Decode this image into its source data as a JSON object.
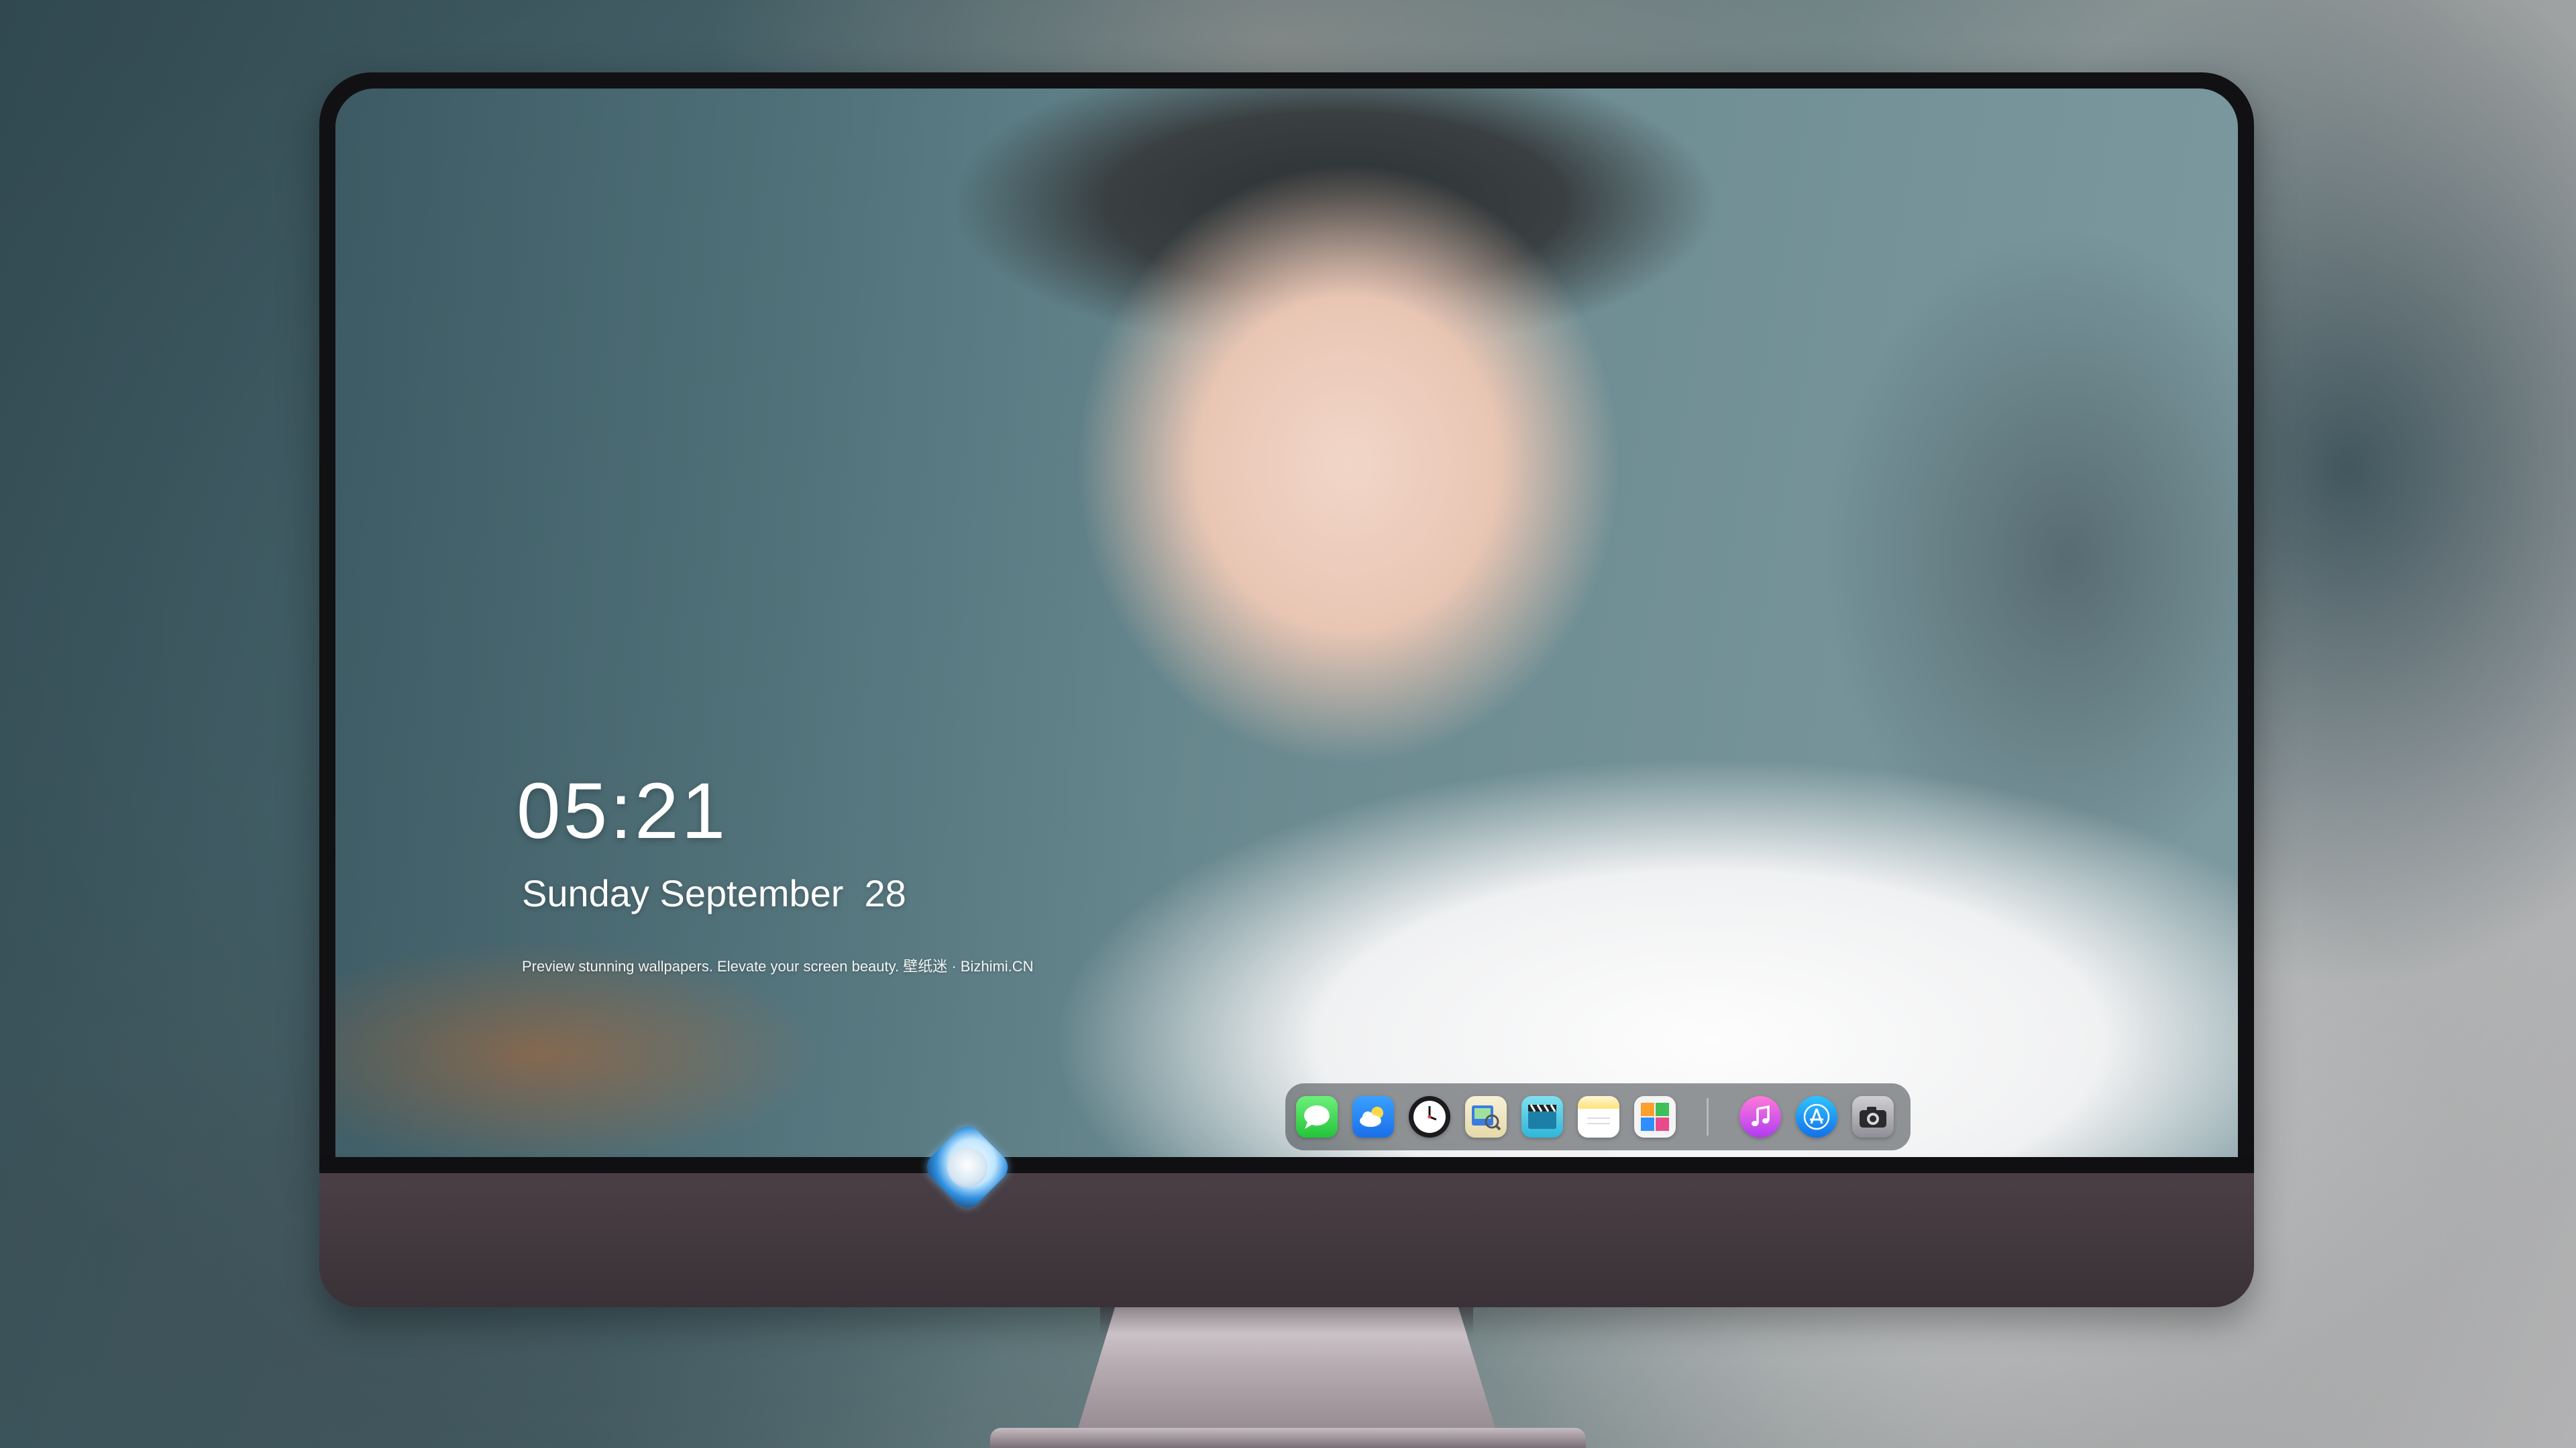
{
  "lockscreen": {
    "time": "05:21",
    "date": "Sunday September  28",
    "tagline": "Preview stunning wallpapers. Elevate your screen beauty. 壁纸迷 · Bizhimi.CN"
  },
  "dock": {
    "apps": [
      {
        "icon": "messages-icon",
        "glyph": "💬"
      },
      {
        "icon": "weather-icon",
        "glyph": "⛅"
      },
      {
        "icon": "clock-icon",
        "glyph": "🕓"
      },
      {
        "icon": "preview-icon",
        "glyph": "🔍"
      },
      {
        "icon": "video-icon",
        "glyph": "🎬"
      },
      {
        "icon": "notes-icon",
        "glyph": "≡"
      },
      {
        "icon": "photos-icon",
        "glyph": "▦"
      },
      {
        "icon": "music-icon",
        "glyph": "♫"
      },
      {
        "icon": "app-store-icon",
        "glyph": "Ⓐ"
      },
      {
        "icon": "camera-icon",
        "glyph": "📷"
      }
    ]
  },
  "chin": {
    "logo_icon": "mascot-logo-icon"
  }
}
